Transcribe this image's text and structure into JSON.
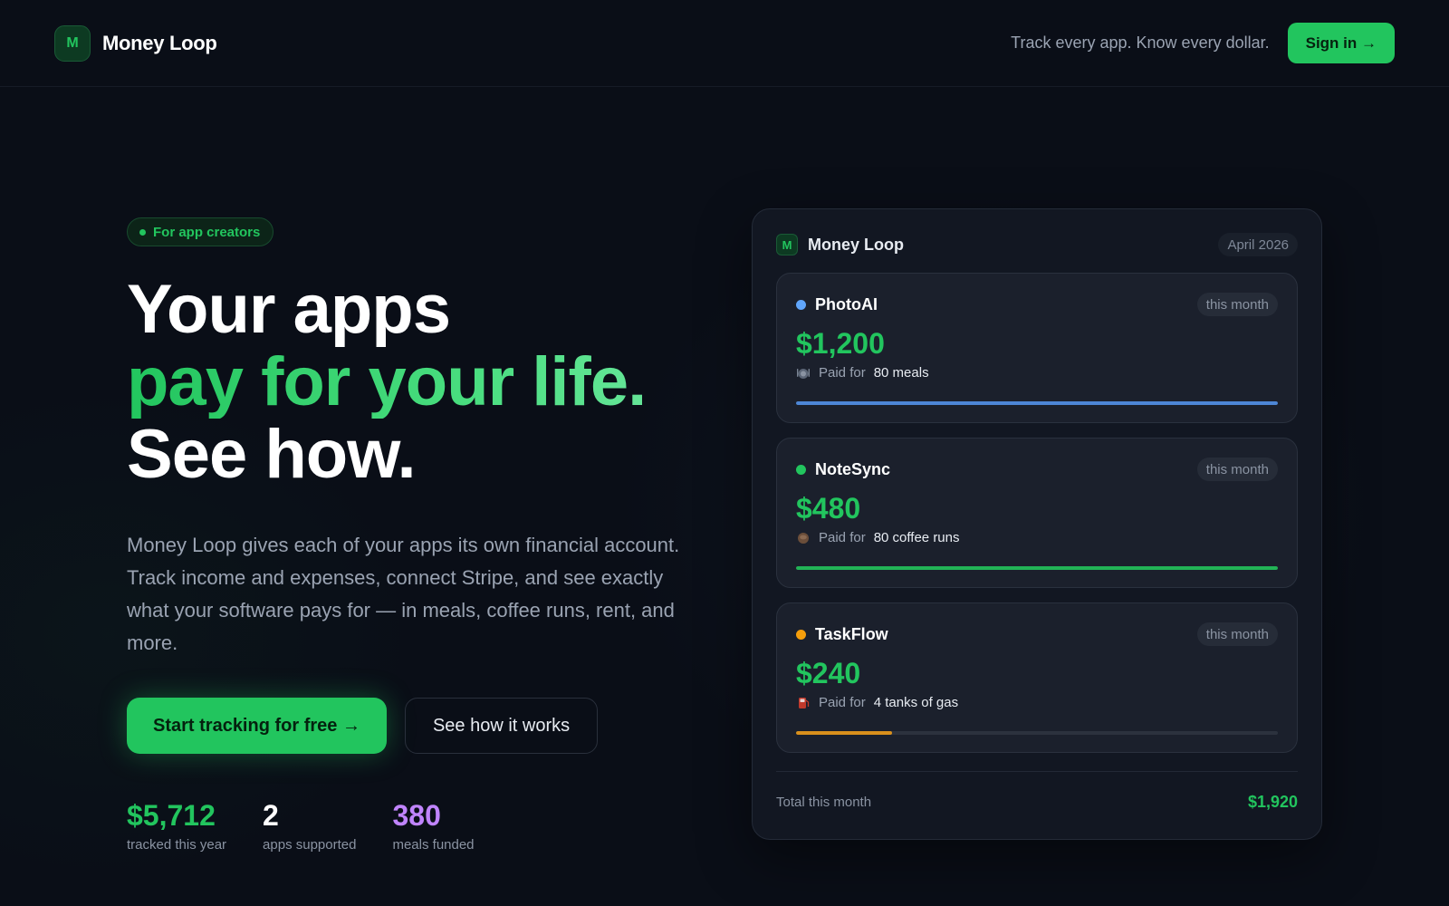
{
  "header": {
    "brand_initial": "M",
    "brand_name": "Money Loop",
    "tagline": "Track every app. Know every dollar.",
    "signin_label": "Sign in →"
  },
  "hero": {
    "pill": "For app creators",
    "headline_line1": "Your apps",
    "headline_line2": "pay for your life.",
    "headline_line3": "See how.",
    "description": "Money Loop gives each of your apps its own financial account. Track income and expenses, connect Stripe, and see exactly what your software pays for — in meals, coffee runs, rent, and more.",
    "cta_primary": "Start tracking for free →",
    "cta_secondary": "See how it works",
    "stats": [
      {
        "value": "$5,712",
        "label": "tracked this year",
        "color": "#22c55e"
      },
      {
        "value": "2",
        "label": "apps supported",
        "color": "#ffffff"
      },
      {
        "value": "380",
        "label": "meals funded",
        "color": "#c084fc"
      }
    ]
  },
  "panel": {
    "brand_initial": "M",
    "title": "Money Loop",
    "month": "April 2026",
    "apps": [
      {
        "name": "PhotoAI",
        "period": "this month",
        "amount": "$1,200",
        "paid_prefix": "Paid for",
        "paid_value": "80 meals",
        "icon": "plate-icon",
        "dot_color": "#60a5fa",
        "bar_color": "#4d86d6",
        "progress": 1.0
      },
      {
        "name": "NoteSync",
        "period": "this month",
        "amount": "$480",
        "paid_prefix": "Paid for",
        "paid_value": "80 coffee runs",
        "icon": "coffee-icon",
        "dot_color": "#22c55e",
        "bar_color": "#22b356",
        "progress": 1.0
      },
      {
        "name": "TaskFlow",
        "period": "this month",
        "amount": "$240",
        "paid_prefix": "Paid for",
        "paid_value": "4 tanks of gas",
        "icon": "fuel-icon",
        "dot_color": "#f59e0b",
        "bar_color": "#d9901c",
        "progress": 0.2
      }
    ],
    "total_label": "Total this month",
    "total_value": "$1,920"
  }
}
